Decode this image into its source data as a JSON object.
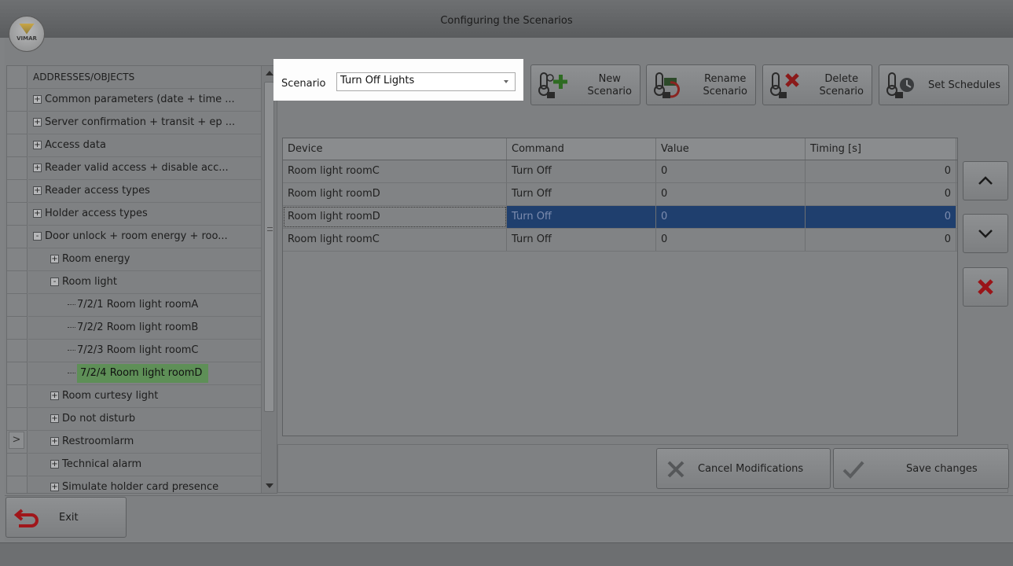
{
  "window": {
    "title": "Configuring the Scenarios",
    "logo_text": "VIMAR"
  },
  "tree": {
    "header": "ADDRESSES/OBJECTS",
    "rows": [
      {
        "label": "Common parameters (date + time ...",
        "level": 0,
        "expander": "+"
      },
      {
        "label": "Server confirmation + transit + ep ...",
        "level": 0,
        "expander": "+"
      },
      {
        "label": "Access data",
        "level": 0,
        "expander": "+"
      },
      {
        "label": "Reader valid access + disable acc...",
        "level": 0,
        "expander": "+"
      },
      {
        "label": "Reader access types",
        "level": 0,
        "expander": "+"
      },
      {
        "label": "Holder access types",
        "level": 0,
        "expander": "+"
      },
      {
        "label": "Door unlock + room energy + roo...",
        "level": 0,
        "expander": "-"
      },
      {
        "label": "Room energy",
        "level": 1,
        "expander": "+"
      },
      {
        "label": "Room light",
        "level": 1,
        "expander": "-"
      },
      {
        "label": "7/2/1 Room light roomA",
        "level": 2,
        "expander": ""
      },
      {
        "label": "7/2/2 Room light roomB",
        "level": 2,
        "expander": ""
      },
      {
        "label": "7/2/3 Room light roomC",
        "level": 2,
        "expander": ""
      },
      {
        "label": "7/2/4 Room light roomD",
        "level": 2,
        "expander": "",
        "selected": true
      },
      {
        "label": "Room curtesy light",
        "level": 1,
        "expander": "+"
      },
      {
        "label": "Do not disturb",
        "level": 1,
        "expander": "+"
      },
      {
        "label": "Restroomlarm",
        "level": 1,
        "expander": "+"
      },
      {
        "label": "Technical alarm",
        "level": 1,
        "expander": "+"
      },
      {
        "label": "Simulate holder card presence",
        "level": 1,
        "expander": "+"
      }
    ],
    "gutter_arrow": ">"
  },
  "scenario": {
    "label": "Scenario",
    "selected": "Turn Off Lights"
  },
  "toolbar": {
    "new_line1": "New",
    "new_line2": "Scenario",
    "rename_line1": "Rename",
    "rename_line2": "Scenario",
    "delete_line1": "Delete",
    "delete_line2": "Scenario",
    "schedules": "Set Schedules"
  },
  "grid": {
    "columns": [
      "Device",
      "Command",
      "Value",
      "Timing [s]"
    ],
    "rows": [
      {
        "device": "Room light roomC",
        "command": "Turn Off",
        "value": "0",
        "timing": "0"
      },
      {
        "device": "Room light roomD",
        "command": "Turn Off",
        "value": "0",
        "timing": "0"
      },
      {
        "device": "Room light roomD",
        "command": "Turn Off",
        "value": "0",
        "timing": "0",
        "selected": true
      },
      {
        "device": "Room light roomC",
        "command": "Turn Off",
        "value": "0",
        "timing": "0"
      }
    ]
  },
  "actions": {
    "cancel": "Cancel Modifications",
    "save": "Save changes",
    "exit": "Exit"
  },
  "colors": {
    "accent_red": "#b0161b",
    "selection_blue": "#1f3f6e",
    "tree_selected_green": "#5e8f57",
    "check_gray": "#5a5c5e"
  }
}
